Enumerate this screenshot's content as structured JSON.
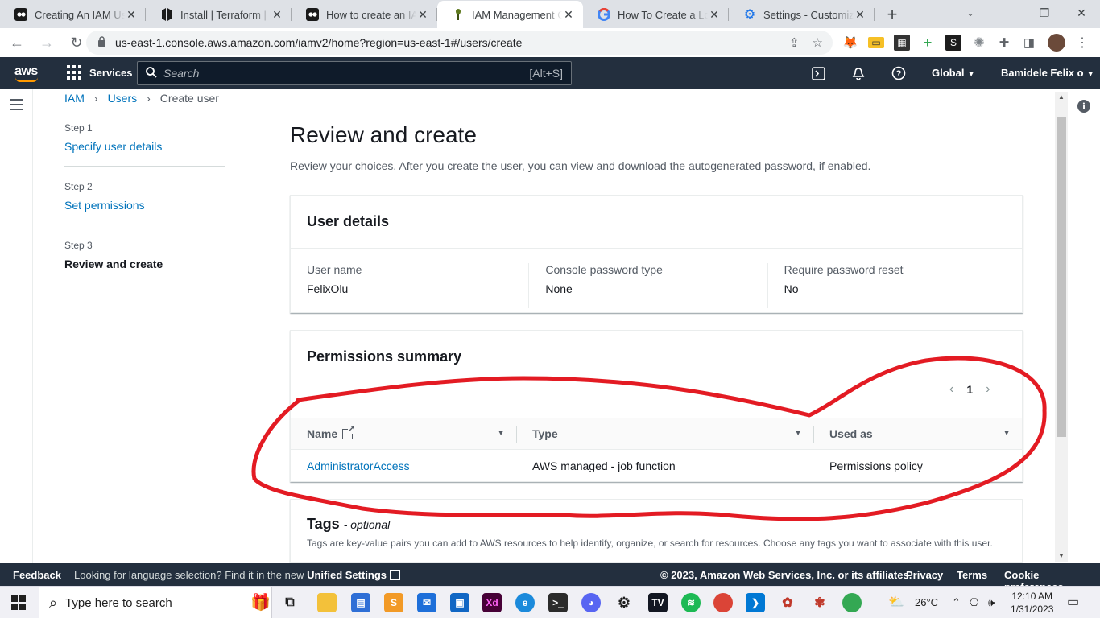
{
  "browser": {
    "tabs": [
      {
        "title": "Creating An IAM User"
      },
      {
        "title": "Install | Terraform | HashiCorp"
      },
      {
        "title": "How to create an IAM user"
      },
      {
        "title": "IAM Management Console"
      },
      {
        "title": "How To Create a Load Balancer"
      },
      {
        "title": "Settings - Customize profile"
      }
    ],
    "url": "us-east-1.console.aws.amazon.com/iamv2/home?region=us-east-1#/users/create"
  },
  "awsnav": {
    "services_label": "Services",
    "search_placeholder": "Search",
    "search_shortcut": "[Alt+S]",
    "region": "Global",
    "account": "Bamidele Felix o"
  },
  "breadcrumb": {
    "items": [
      "IAM",
      "Users",
      "Create user"
    ]
  },
  "steps": [
    {
      "num": "Step 1",
      "label": "Specify user details"
    },
    {
      "num": "Step 2",
      "label": "Set permissions"
    },
    {
      "num": "Step 3",
      "label": "Review and create"
    }
  ],
  "page": {
    "title": "Review and create",
    "description": "Review your choices. After you create the user, you can view and download the autogenerated password, if enabled."
  },
  "user_details": {
    "title": "User details",
    "fields": [
      {
        "label": "User name",
        "value": "FelixOlu"
      },
      {
        "label": "Console password type",
        "value": "None"
      },
      {
        "label": "Require password reset",
        "value": "No"
      }
    ]
  },
  "permissions": {
    "title": "Permissions summary",
    "page": "1",
    "columns": [
      "Name",
      "Type",
      "Used as"
    ],
    "rows": [
      {
        "name": "AdministratorAccess",
        "type": "AWS managed - job function",
        "used_as": "Permissions policy"
      }
    ]
  },
  "tags": {
    "title": "Tags",
    "optional": "- optional",
    "description": "Tags are key-value pairs you can add to AWS resources to help identify, organize, or search for resources. Choose any tags you want to associate with this user."
  },
  "footer": {
    "feedback": "Feedback",
    "lang_prefix": "Looking for language selection? Find it in the new",
    "lang_link": "Unified Settings",
    "copyright": "© 2023, Amazon Web Services, Inc. or its affiliates.",
    "privacy": "Privacy",
    "terms": "Terms",
    "cookies": "Cookie preferences"
  },
  "taskbar": {
    "search_placeholder": "Type here to search",
    "temperature": "26°C",
    "time": "12:10 AM",
    "date": "1/31/2023"
  },
  "colors": {
    "aws_nav": "#232f3e",
    "link": "#0073bb",
    "annotation": "#e31b23",
    "aws_orange": "#ff9900"
  }
}
